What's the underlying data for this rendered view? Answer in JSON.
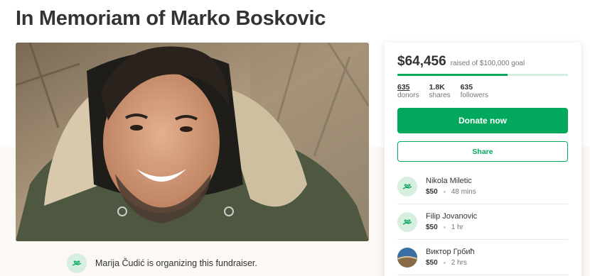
{
  "page": {
    "title": "In Memoriam of Marko Boskovic"
  },
  "hero": {
    "icon": "fundraiser-photo"
  },
  "organizer": {
    "text": "Marija Čudić is organizing this fundraiser.",
    "icon": "heart-hand-icon"
  },
  "campaign": {
    "raised": "$64,456",
    "goal_text": "raised of $100,000 goal",
    "progress_fraction": 0.64456,
    "stats": [
      {
        "value": "635",
        "label": "donors"
      },
      {
        "value": "1.8K",
        "label": "shares"
      },
      {
        "value": "635",
        "label": "followers"
      }
    ],
    "donate_label": "Donate now",
    "share_label": "Share"
  },
  "donations": [
    {
      "name": "Nikola Miletic",
      "amount": "$50",
      "time": "48 mins",
      "avatar": "heart-hand-icon"
    },
    {
      "name": "Filip Jovanovic",
      "amount": "$50",
      "time": "1 hr",
      "avatar": "heart-hand-icon"
    },
    {
      "name": "Виктор Грбић",
      "amount": "$50",
      "time": "2 hrs",
      "avatar": "photo"
    }
  ],
  "colors": {
    "accent": "#02a95c",
    "accent_light": "#d7efe0",
    "text": "#333333",
    "muted": "#767676"
  }
}
